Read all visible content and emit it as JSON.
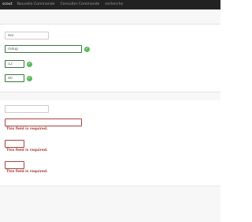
{
  "nav": {
    "brand": "scout",
    "items": [
      "Nouvelle Commande",
      "Consulter Commande",
      "recherche"
    ]
  },
  "form_valid": {
    "field1_value": "Rol",
    "field2_value": "rollup",
    "field3_value": "12",
    "field4_value": "40",
    "check_icon": "checkmark-circle-icon"
  },
  "form_invalid": {
    "field1_value": "",
    "field2_value": "",
    "field3_value": "",
    "field4_value": "",
    "error_message": "This field is required."
  },
  "colors": {
    "navbar": "#222222",
    "valid_border": "#3c763d",
    "error_border": "#a94442",
    "check_green": "#5cb85c"
  }
}
